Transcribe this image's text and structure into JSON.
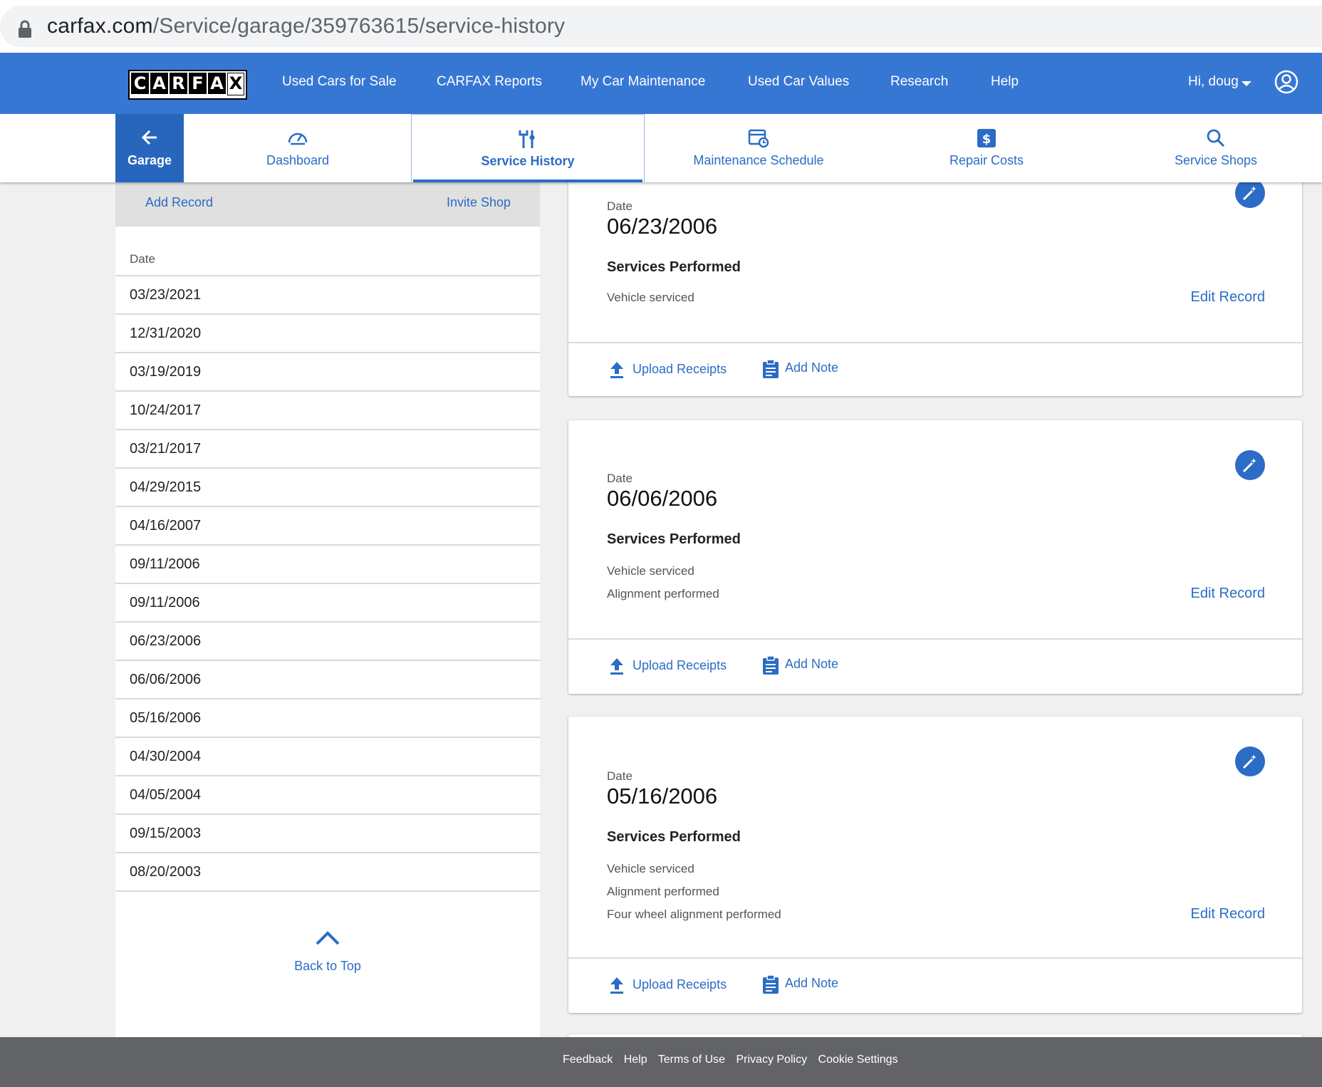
{
  "browser": {
    "url_host": "carfax.com",
    "url_path": "/Service/garage/359763615/service-history"
  },
  "topnav": {
    "logo_letters": [
      "C",
      "A",
      "R",
      "F",
      "A",
      "X"
    ],
    "links": [
      "Used Cars for Sale",
      "CARFAX Reports",
      "My Car Maintenance",
      "Used Car Values",
      "Research",
      "Help"
    ],
    "user_greeting": "Hi, doug"
  },
  "subnav": {
    "garage_label": "Garage",
    "tabs": [
      "Dashboard",
      "Service History",
      "Maintenance Schedule",
      "Repair Costs",
      "Service Shops"
    ],
    "active_tab": "Service History"
  },
  "leftpanel": {
    "add_record": "Add Record",
    "invite_shop": "Invite Shop",
    "date_header": "Date",
    "dates": [
      "03/23/2021",
      "12/31/2020",
      "03/19/2019",
      "10/24/2017",
      "03/21/2017",
      "04/29/2015",
      "04/16/2007",
      "09/11/2006",
      "09/11/2006",
      "06/23/2006",
      "06/06/2006",
      "05/16/2006",
      "04/30/2004",
      "04/05/2004",
      "09/15/2003",
      "08/20/2003"
    ],
    "back_to_top": "Back to Top"
  },
  "records": [
    {
      "date_label": "Date",
      "date": "06/23/2006",
      "services_header": "Services Performed",
      "services": [
        "Vehicle serviced"
      ],
      "edit": "Edit Record",
      "upload": "Upload Receipts",
      "note": "Add Note"
    },
    {
      "date_label": "Date",
      "date": "06/06/2006",
      "services_header": "Services Performed",
      "services": [
        "Vehicle serviced",
        "Alignment performed"
      ],
      "edit": "Edit Record",
      "upload": "Upload Receipts",
      "note": "Add Note"
    },
    {
      "date_label": "Date",
      "date": "05/16/2006",
      "services_header": "Services Performed",
      "services": [
        "Vehicle serviced",
        "Alignment performed",
        "Four wheel alignment performed"
      ],
      "edit": "Edit Record",
      "upload": "Upload Receipts",
      "note": "Add Note"
    }
  ],
  "footer": {
    "links": [
      "Feedback",
      "Help",
      "Terms of Use",
      "Privacy Policy",
      "Cookie Settings"
    ]
  },
  "colors": {
    "brand_blue": "#3777d4",
    "link_blue": "#2b6cc4",
    "garage_blue": "#2866be",
    "footer_gray": "#626366"
  }
}
